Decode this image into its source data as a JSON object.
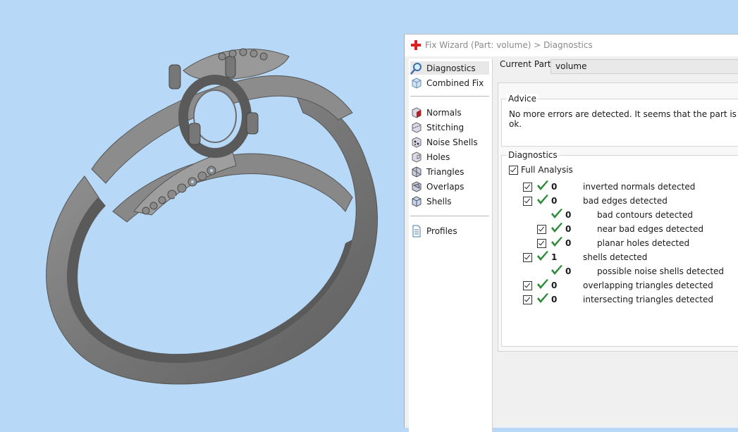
{
  "window": {
    "title": "Fix Wizard (Part: volume) > Diagnostics"
  },
  "nav": {
    "items_top": [
      {
        "label": "Diagnostics",
        "icon": "magnifier-icon",
        "selected": true
      },
      {
        "label": "Combined Fix",
        "icon": "combined-fix-icon"
      }
    ],
    "items_mid": [
      {
        "label": "Normals",
        "icon": "normals-icon"
      },
      {
        "label": "Stitching",
        "icon": "stitching-icon"
      },
      {
        "label": "Noise Shells",
        "icon": "noise-shells-icon"
      },
      {
        "label": "Holes",
        "icon": "holes-icon"
      },
      {
        "label": "Triangles",
        "icon": "triangles-icon"
      },
      {
        "label": "Overlaps",
        "icon": "overlaps-icon"
      },
      {
        "label": "Shells",
        "icon": "shells-icon"
      }
    ],
    "items_bottom": [
      {
        "label": "Profiles",
        "icon": "profiles-icon"
      }
    ]
  },
  "current_part": {
    "label": "Current Part:",
    "value": "volume"
  },
  "advice": {
    "title": "Advice",
    "text": "No more errors are detected. It seems that the part is ok."
  },
  "diagnostics": {
    "title": "Diagnostics",
    "full_analysis_label": "Full Analysis",
    "rows": [
      {
        "count": "0",
        "label": "inverted normals detected",
        "checkbox": true,
        "indent": 0
      },
      {
        "count": "0",
        "label": "bad edges detected",
        "checkbox": true,
        "indent": 0
      },
      {
        "count": "0",
        "label": "bad contours detected",
        "checkbox": false,
        "indent": 1
      },
      {
        "count": "0",
        "label": "near bad edges detected",
        "checkbox": true,
        "indent": 1
      },
      {
        "count": "0",
        "label": "planar holes detected",
        "checkbox": true,
        "indent": 1
      },
      {
        "count": "1",
        "label": "shells detected",
        "checkbox": true,
        "indent": 0
      },
      {
        "count": "0",
        "label": "possible noise shells detected",
        "checkbox": false,
        "indent": 1
      },
      {
        "count": "0",
        "label": "overlapping triangles detected",
        "checkbox": true,
        "indent": 0
      },
      {
        "count": "0",
        "label": "intersecting triangles detected",
        "checkbox": true,
        "indent": 0
      }
    ]
  },
  "colors": {
    "viewport_bg": "#b7d9f7",
    "model_gray": "#7d7d7d",
    "check_green": "#2e8b3a",
    "app_icon_red": "#e02020"
  }
}
